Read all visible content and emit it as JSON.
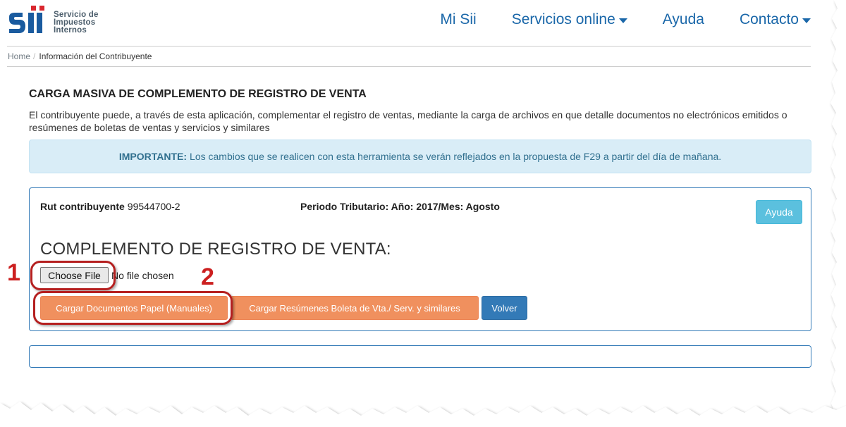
{
  "header": {
    "logo_lines": [
      "Servicio de",
      "Impuestos",
      "Internos"
    ],
    "nav": [
      {
        "label": "Mi Sii",
        "dropdown": false
      },
      {
        "label": "Servicios online",
        "dropdown": true
      },
      {
        "label": "Ayuda",
        "dropdown": false
      },
      {
        "label": "Contacto",
        "dropdown": true
      }
    ]
  },
  "breadcrumb": {
    "home": "Home",
    "separator": "/",
    "current": "Información del Contribuyente"
  },
  "main": {
    "title": "CARGA MASIVA DE COMPLEMENTO DE REGISTRO DE VENTA",
    "intro": "El contribuyente puede, a través de esta aplicación, complementar el registro de ventas, mediante la carga de archivos en que detalle documentos no electrónicos emitidos o resúmenes de boletas de ventas y servicios y similares",
    "alert": {
      "label": "IMPORTANTE:",
      "text": "Los cambios que se realicen con esta herramienta se verán reflejados en la propuesta de F29 a partir del día de mañana."
    }
  },
  "panel": {
    "rut_label": "Rut contribuyente",
    "rut_value": "99544700-2",
    "periodo": "Periodo Tributario: Año: 2017/Mes: Agosto",
    "ayuda_button": "Ayuda",
    "heading": "COMPLEMENTO DE REGISTRO DE VENTA:",
    "file": {
      "button": "Choose File",
      "status": "No file chosen"
    },
    "buttons": {
      "manuales": "Cargar Documentos Papel (Manuales)",
      "resumenes": "Cargar Resúmenes Boleta de Vta./ Serv. y similares",
      "volver": "Volver"
    }
  },
  "annotations": {
    "step1": "1",
    "step2": "2"
  },
  "colors": {
    "brand_blue": "#1a67a9",
    "alert_bg": "#d9edf7",
    "orange_button": "#f0905e",
    "primary_button": "#337ab7",
    "info_button": "#5bc0de",
    "annotation_red": "#cc1f1f"
  }
}
